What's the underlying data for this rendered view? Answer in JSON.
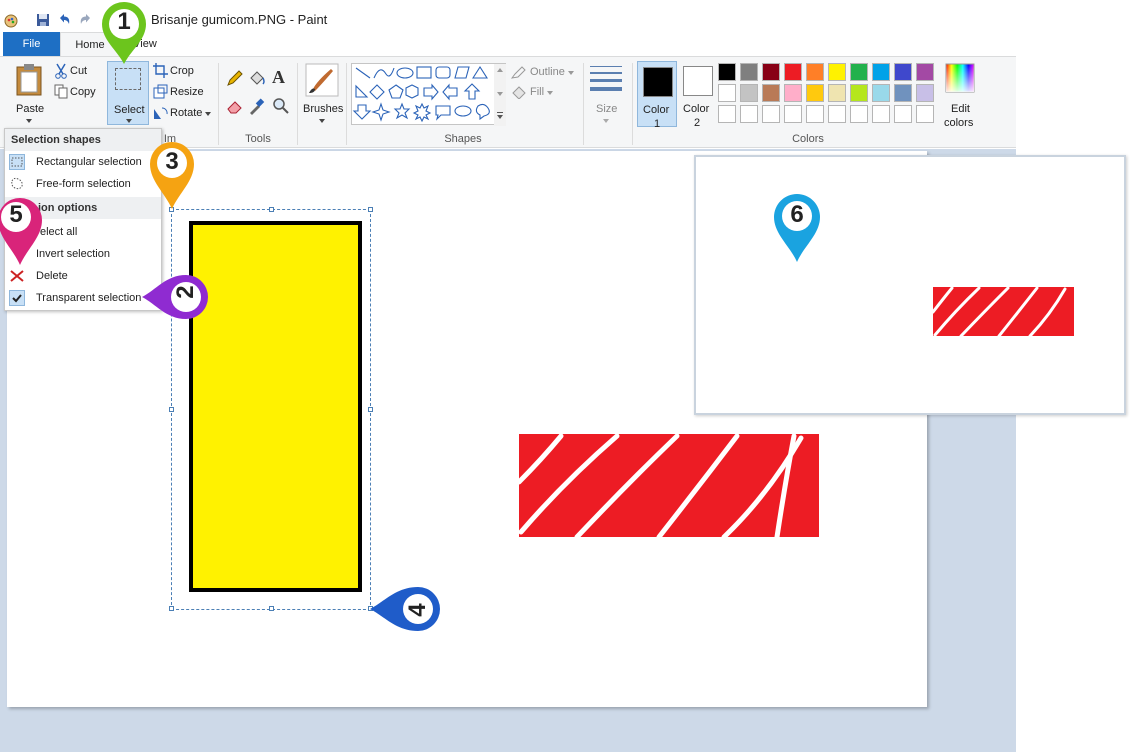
{
  "window": {
    "title": "Brisanje gumicom.PNG - Paint"
  },
  "tabs": [
    {
      "label": "File"
    },
    {
      "label": "Home"
    },
    {
      "label": "View"
    }
  ],
  "ribbon": {
    "clipboard": {
      "paste_label": "Paste",
      "cut_label": "Cut",
      "copy_label": "Copy"
    },
    "image": {
      "select_label": "Select",
      "crop_label": "Crop",
      "resize_label": "Resize",
      "rotate_label": "Rotate",
      "group_label": "Im"
    },
    "tools": {
      "group_label": "Tools"
    },
    "brushes": {
      "label": "Brushes"
    },
    "shapes": {
      "outline_label": "Outline",
      "fill_label": "Fill",
      "group_label": "Shapes"
    },
    "size": {
      "label": "Size"
    },
    "colors": {
      "color1_line1": "Color",
      "color1_line2": "1",
      "color2_line1": "Color",
      "color2_line2": "2",
      "edit_line1": "Edit",
      "edit_line2": "colors",
      "group_label": "Colors",
      "palette_row1": [
        "#000000",
        "#7f7f7f",
        "#880015",
        "#ed1c24",
        "#ff7f27",
        "#fff200",
        "#22b14c",
        "#00a2e8",
        "#3f48cc",
        "#a349a4"
      ],
      "palette_row2": [
        "#ffffff",
        "#c3c3c3",
        "#b97a57",
        "#ffaec9",
        "#ffc90e",
        "#efe4b0",
        "#b5e61d",
        "#99d9ea",
        "#7092be",
        "#c8bfe7"
      ]
    }
  },
  "dropdown": {
    "shapes_header": "Selection shapes",
    "rect_selection": "Rectangular selection",
    "freeform_selection": "Free-form selection",
    "options_header": "ion options",
    "select_all": "elect all",
    "invert_selection": "Invert selection",
    "delete": "Delete",
    "transparent_selection": "Transparent selection"
  },
  "colors": {
    "accent": "#1e6fc4",
    "yellow": "#fff200",
    "red": "#ed1c24"
  },
  "markers": [
    {
      "number": "1",
      "color": "#6cc51d"
    },
    {
      "number": "2",
      "color": "#8f2bd1"
    },
    {
      "number": "3",
      "color": "#f5a312"
    },
    {
      "number": "4",
      "color": "#1f5cc9"
    },
    {
      "number": "5",
      "color": "#d9247a"
    },
    {
      "number": "6",
      "color": "#1aa3e0"
    }
  ]
}
